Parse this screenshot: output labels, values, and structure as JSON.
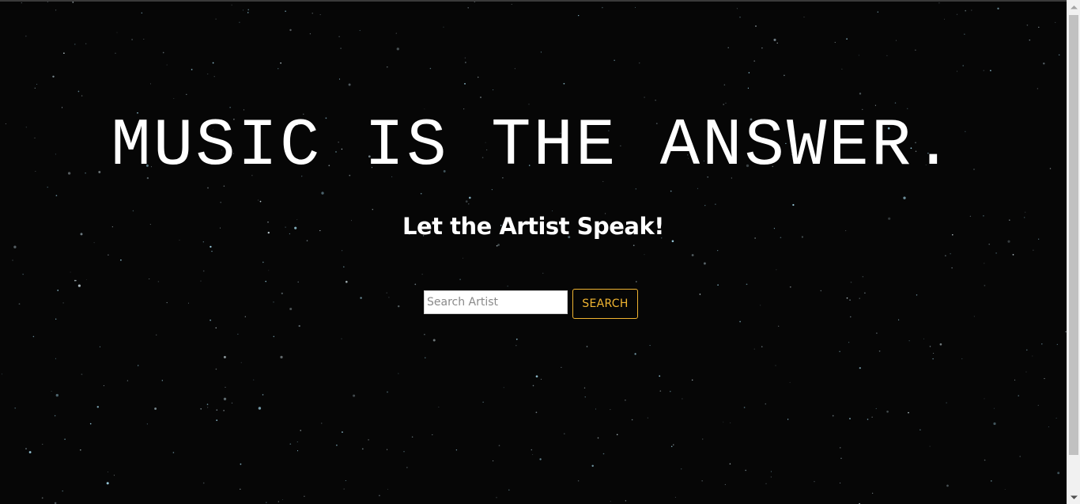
{
  "hero": {
    "title": "MUSIC IS THE ANSWER.",
    "subtitle": "Let the Artist Speak!"
  },
  "search": {
    "placeholder": "Search Artist",
    "value": "",
    "button_label": "SEARCH"
  },
  "colors": {
    "background": "#060606",
    "title": "#ffffff",
    "accent": "#f0b431"
  },
  "icons": {
    "scroll_up": "chevron-up-icon",
    "scroll_down": "chevron-down-icon"
  }
}
